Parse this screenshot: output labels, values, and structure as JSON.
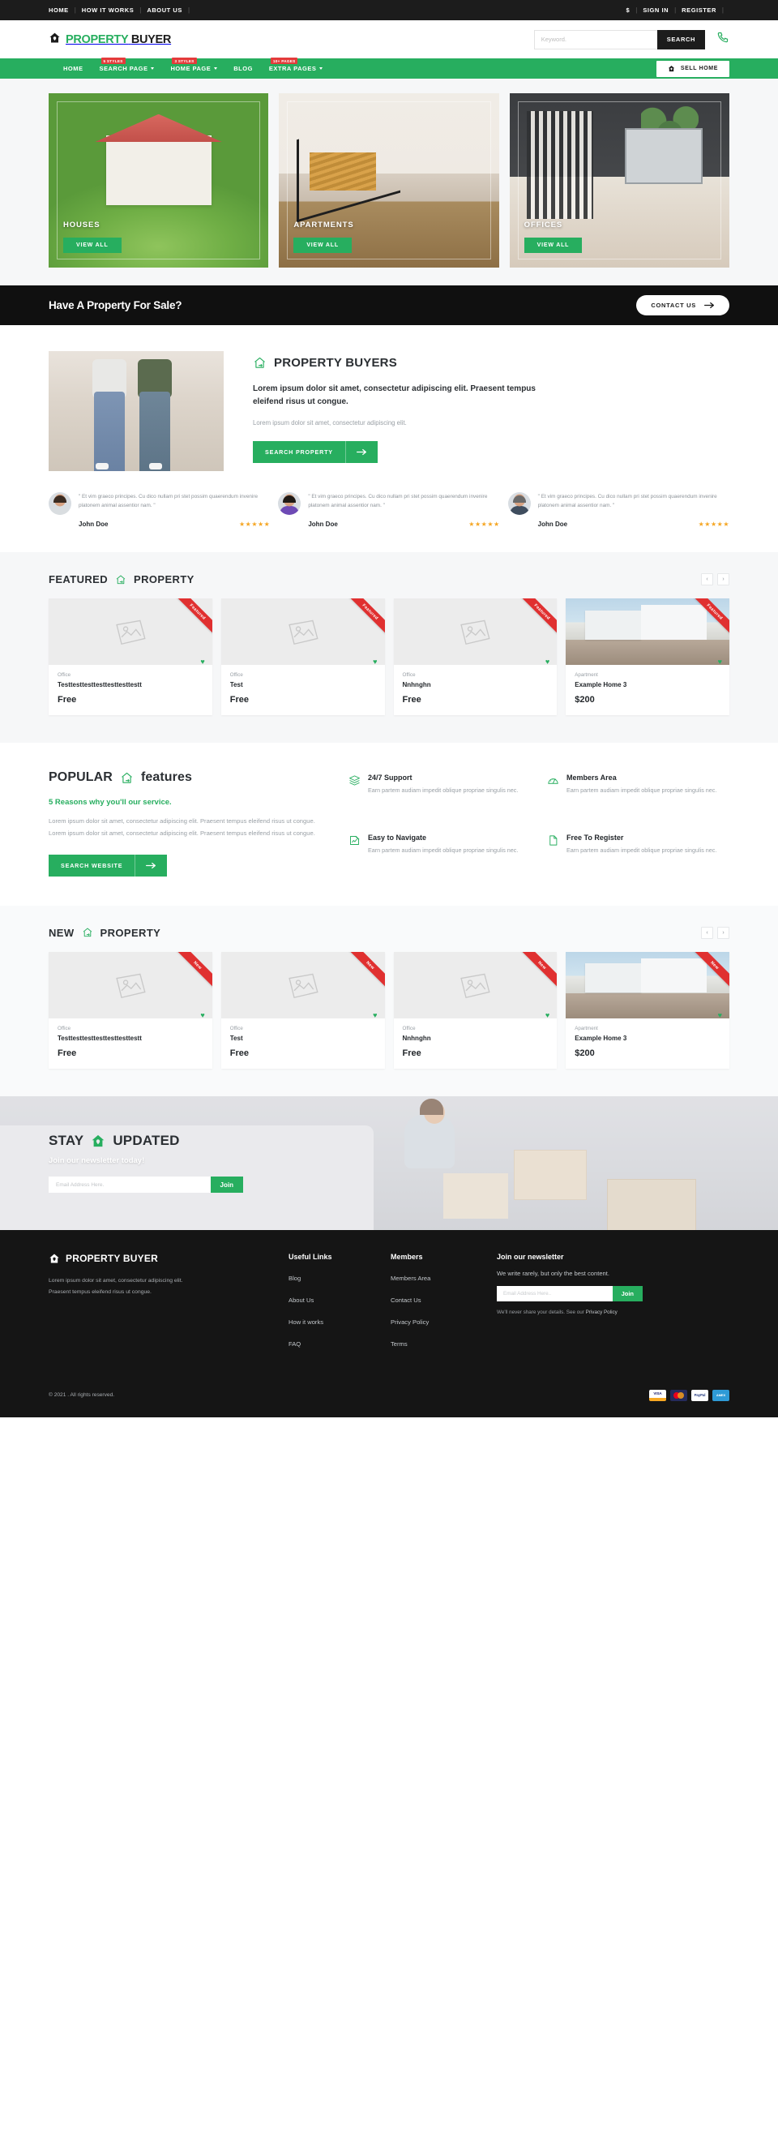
{
  "topbar": {
    "left_links": [
      "HOME",
      "HOW IT WORKS",
      "ABOUT US"
    ],
    "currency": "$",
    "right_links": [
      "SIGN IN",
      "REGISTER"
    ]
  },
  "header": {
    "brand_primary": "PROPERTY",
    "brand_secondary": "BUYER",
    "search_placeholder": "Keyword.",
    "search_value": "",
    "search_button": "SEARCH",
    "phone_icon": "phone-icon"
  },
  "nav": {
    "items": [
      {
        "label": "HOME",
        "caret": false,
        "badge": ""
      },
      {
        "label": "SEARCH PAGE",
        "caret": true,
        "badge": "5 STYLES"
      },
      {
        "label": "HOME PAGE",
        "caret": true,
        "badge": "3 STYLES"
      },
      {
        "label": "BLOG",
        "caret": false,
        "badge": ""
      },
      {
        "label": "EXTRA PAGES",
        "caret": true,
        "badge": "10+ PAGES"
      }
    ],
    "sell_home": "SELL HOME"
  },
  "hero": {
    "cards": [
      {
        "title": "HOUSES",
        "button": "VIEW ALL"
      },
      {
        "title": "APARTMENTS",
        "button": "VIEW ALL"
      },
      {
        "title": "OFFICES",
        "button": "VIEW ALL"
      }
    ]
  },
  "cta": {
    "heading": "Have A Property For Sale?",
    "button": "CONTACT US"
  },
  "about": {
    "title": "PROPERTY BUYERS",
    "lead": "Lorem ipsum dolor sit amet, consectetur adipiscing elit. Praesent tempus eleifend risus ut congue.",
    "sub": "Lorem ipsum dolor sit amet, consectetur adipiscing elit.",
    "button": "SEARCH PROPERTY"
  },
  "testimonials": [
    {
      "quote": "\" Et vim graeco principes. Cu dico nullam pri stet possim quaerendum invenire platonem animal assentior nam. \"",
      "name": "John Doe",
      "stars": "★★★★★"
    },
    {
      "quote": "\" Et vim graeco principes. Cu dico nullam pri stet possim quaerendum invenire platonem animal assentior nam. \"",
      "name": "John Doe",
      "stars": "★★★★★"
    },
    {
      "quote": "\" Et vim graeco principes. Cu dico nullam pri stet possim quaerendum invenire platonem animal assentior nam. \"",
      "name": "John Doe",
      "stars": "★★★★★"
    }
  ],
  "featured": {
    "title_1": "FEATURED",
    "title_2": "PROPERTY",
    "prev": "‹",
    "next": "›",
    "items": [
      {
        "ribbon": "Featured",
        "type": "Office",
        "name": "Testtesttesttesttesttesttestt",
        "price": "Free"
      },
      {
        "ribbon": "Featured",
        "type": "Office",
        "name": "Test",
        "price": "Free"
      },
      {
        "ribbon": "Featured",
        "type": "Office",
        "name": "Nnhnghn",
        "price": "Free"
      },
      {
        "ribbon": "Featured",
        "type": "Apartment",
        "name": "Example Home 3",
        "price": "$200"
      }
    ]
  },
  "features": {
    "title_1": "POPULAR",
    "title_2": "features",
    "subtitle": "5 Reasons why you'll our service.",
    "paragraph": "Lorem ipsum dolor sit amet, consectetur adipiscing elit. Praesent tempus eleifend risus ut congue. Lorem ipsum dolor sit amet, consectetur adipiscing elit. Praesent tempus eleifend risus ut congue.",
    "button": "SEARCH WEBSITE",
    "items": [
      {
        "icon": "layers-icon",
        "title": "24/7 Support",
        "text": "Earn partem audiam impedit oblique propriae singulis nec."
      },
      {
        "icon": "gauge-icon",
        "title": "Members Area",
        "text": "Earn partem audiam impedit oblique propriae singulis nec."
      },
      {
        "icon": "pencil-edit-icon",
        "title": "Easy to Navigate",
        "text": "Earn partem audiam impedit oblique propriae singulis nec."
      },
      {
        "icon": "document-icon",
        "title": "Free To Register",
        "text": "Earn partem audiam impedit oblique propriae singulis nec."
      }
    ]
  },
  "newproperty": {
    "title_1": "NEW",
    "title_2": "PROPERTY",
    "prev": "‹",
    "next": "›",
    "items": [
      {
        "ribbon": "New",
        "type": "Office",
        "name": "Testtesttesttesttesttesttestt",
        "price": "Free"
      },
      {
        "ribbon": "New",
        "type": "Office",
        "name": "Test",
        "price": "Free"
      },
      {
        "ribbon": "New",
        "type": "Office",
        "name": "Nnhnghn",
        "price": "Free"
      },
      {
        "ribbon": "New",
        "type": "Apartment",
        "name": "Example Home 3",
        "price": "$200"
      }
    ]
  },
  "newsletter": {
    "title_1": "STAY",
    "title_2": "UPDATED",
    "subtitle": "Join our newsletter today!",
    "placeholder": "Email Address Here.",
    "value": "",
    "button": "Join"
  },
  "footer": {
    "brand": "PROPERTY BUYER",
    "desc_line1": "Lorem ipsum dolor sit amet, consectetur adipiscing elit.",
    "desc_line2": "Praesent tempus eleifend risus ut congue.",
    "links_heading": "Useful Links",
    "links": [
      "Blog",
      "About Us",
      "How it works",
      "FAQ"
    ],
    "members_heading": "Members",
    "members": [
      "Members Area",
      "Contact Us",
      "Privacy Policy",
      "Terms"
    ],
    "news_heading": "Join our newsletter",
    "news_sub": "We write rarely, but only the best content.",
    "news_placeholder": "Email Address Here..",
    "news_value": "",
    "news_button": "Join",
    "fine_text": "We'll never share your details. See our ",
    "fine_link": "Privacy Policy",
    "copyright": "© 2021 . All rights reserved.",
    "payments": [
      "VISA",
      "mastercard",
      "PayPal",
      "AMEX"
    ]
  },
  "colors": {
    "brand_green": "#27ae5f",
    "dark": "#1c1c1c",
    "ribbon_red": "#e03030",
    "star_gold": "#f5a623"
  }
}
